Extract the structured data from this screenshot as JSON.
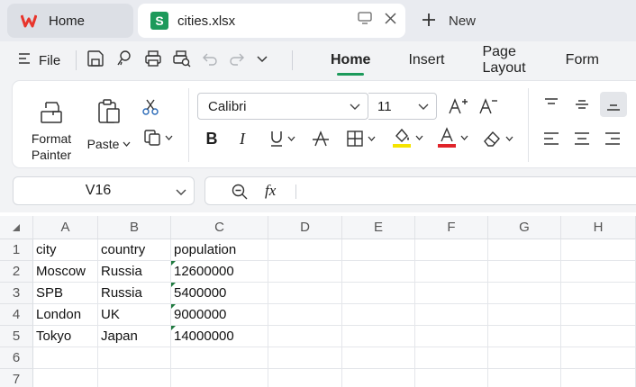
{
  "tabs": {
    "home_label": "Home",
    "file_label": "cities.xlsx",
    "file_badge": "S",
    "new_label": "New"
  },
  "menu": {
    "file_label": "File",
    "tabs": [
      "Home",
      "Insert",
      "Page Layout",
      "Form"
    ]
  },
  "ribbon": {
    "format_painter_line1": "Format",
    "format_painter_line2": "Painter",
    "paste_label": "Paste",
    "font_name": "Calibri",
    "font_size": "11",
    "font_color": "#e0242a",
    "highlight_color": "#f5e400"
  },
  "formula": {
    "cell_ref": "V16",
    "fx_label": "fx",
    "value": ""
  },
  "sheet": {
    "columns": [
      "A",
      "B",
      "C",
      "D",
      "E",
      "F",
      "G",
      "H"
    ],
    "rows": [
      "1",
      "2",
      "3",
      "4",
      "5",
      "6",
      "7"
    ],
    "cells": [
      [
        "city",
        "country",
        "population"
      ],
      [
        "Moscow",
        "Russia",
        "12600000"
      ],
      [
        "SPB",
        "Russia",
        "5400000"
      ],
      [
        "London",
        "UK",
        "9000000"
      ],
      [
        "Tokyo",
        "Japan",
        "14000000"
      ]
    ]
  },
  "colors": {
    "accent": "#1d9a5b",
    "wps_logo": "#e8352c"
  }
}
